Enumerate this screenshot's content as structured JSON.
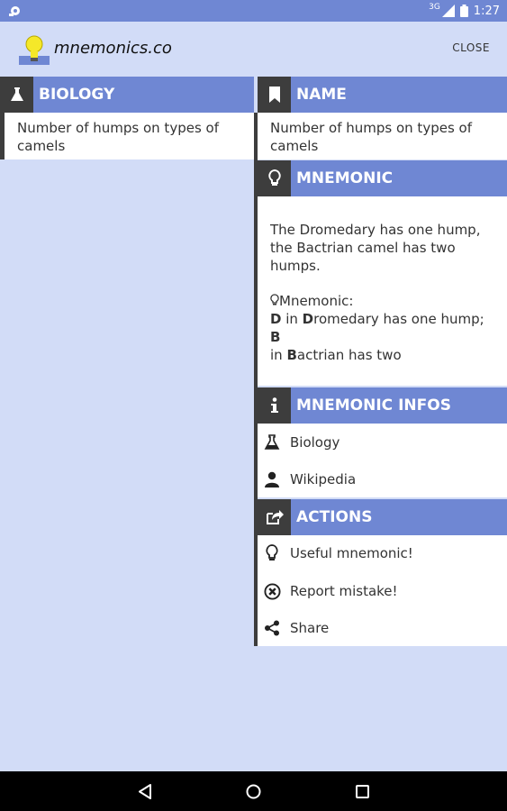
{
  "status_bar": {
    "time": "1:27",
    "network": "3G"
  },
  "app": {
    "title": "mnemonics.co",
    "close_label": "CLOSE"
  },
  "category_panel": {
    "title": "BIOLOGY",
    "item": "Number of humps on types of camels"
  },
  "name_panel": {
    "title": "NAME",
    "value": "Number of humps on types of camels"
  },
  "mnemonic_panel": {
    "title": "MNEMONIC",
    "description": "The Dromedary has one hump, the Bactrian camel has two humps.",
    "label": "Mnemonic:",
    "part1_bold": "D",
    "part1_text": " in ",
    "part2_bold": "D",
    "part2_text": "romedary has one hump; ",
    "part3_bold": "B",
    "part3_text": " in ",
    "part4_bold": "B",
    "part4_text": "actrian has two"
  },
  "infos_panel": {
    "title": "MNEMONIC INFOS",
    "category": "Biology",
    "source": "Wikipedia"
  },
  "actions_panel": {
    "title": "ACTIONS",
    "useful": "Useful mnemonic!",
    "report": "Report mistake!",
    "share": "Share"
  },
  "colors": {
    "accent": "#6f87d3",
    "dark": "#3d3d3d",
    "background": "#d2dcf7"
  }
}
